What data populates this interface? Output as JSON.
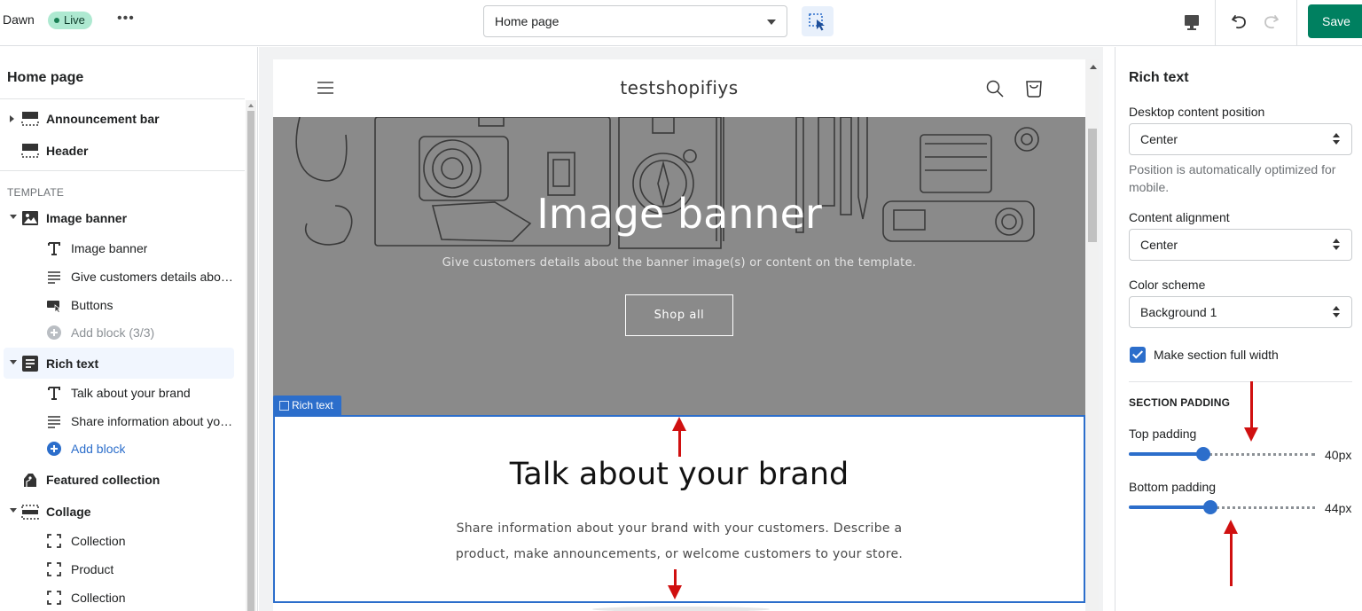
{
  "topbar": {
    "theme_name": "Dawn",
    "status_badge": "Live",
    "more_label": "•••",
    "page_select_value": "Home page",
    "save_label": "Save"
  },
  "sidebar": {
    "title": "Home page",
    "template_label": "TEMPLATE",
    "items": [
      {
        "label": "Announcement bar",
        "icon": "section-icon"
      },
      {
        "label": "Header",
        "icon": "section-icon"
      },
      {
        "label": "Image banner",
        "icon": "image-icon"
      },
      {
        "label": "Rich text",
        "icon": "text-block-icon"
      },
      {
        "label": "Featured collection",
        "icon": "tag-icon"
      },
      {
        "label": "Collage",
        "icon": "section-icon"
      }
    ],
    "image_banner_blocks": [
      "Image banner",
      "Give customers details about the banner image(s) or content on the template.",
      "Buttons"
    ],
    "image_banner_add": "Add block (3/3)",
    "rich_text_blocks": [
      "Talk about your brand",
      "Share information about your brand with your customers."
    ],
    "rich_text_add": "Add block",
    "collage_blocks": [
      "Collection",
      "Product",
      "Collection"
    ]
  },
  "preview": {
    "store_name": "testshopifiys",
    "banner_heading": "Image banner",
    "banner_text": "Give customers details about the banner image(s) or content on the template.",
    "banner_button": "Shop all",
    "section_tag": "Rich text",
    "rich_text_heading": "Talk about your brand",
    "rich_text_body": "Share information about your brand with your customers. Describe a product, make announcements, or welcome customers to your store."
  },
  "settings": {
    "title": "Rich text",
    "desktop_position_label": "Desktop content position",
    "desktop_position_value": "Center",
    "position_help": "Position is automatically optimized for mobile.",
    "alignment_label": "Content alignment",
    "alignment_value": "Center",
    "color_scheme_label": "Color scheme",
    "color_scheme_value": "Background 1",
    "full_width_label": "Make section full width",
    "full_width_checked": true,
    "padding_heading": "SECTION PADDING",
    "top_padding_label": "Top padding",
    "top_padding_value": "40px",
    "top_padding_fraction": 0.4,
    "bottom_padding_label": "Bottom padding",
    "bottom_padding_value": "44px",
    "bottom_padding_fraction": 0.44
  },
  "colors": {
    "accent": "#2c6ecb",
    "save": "#008060",
    "live_badge": "#aee9d1",
    "banner_bg": "#8a8a8a",
    "annotation_arrow": "#d01010"
  }
}
